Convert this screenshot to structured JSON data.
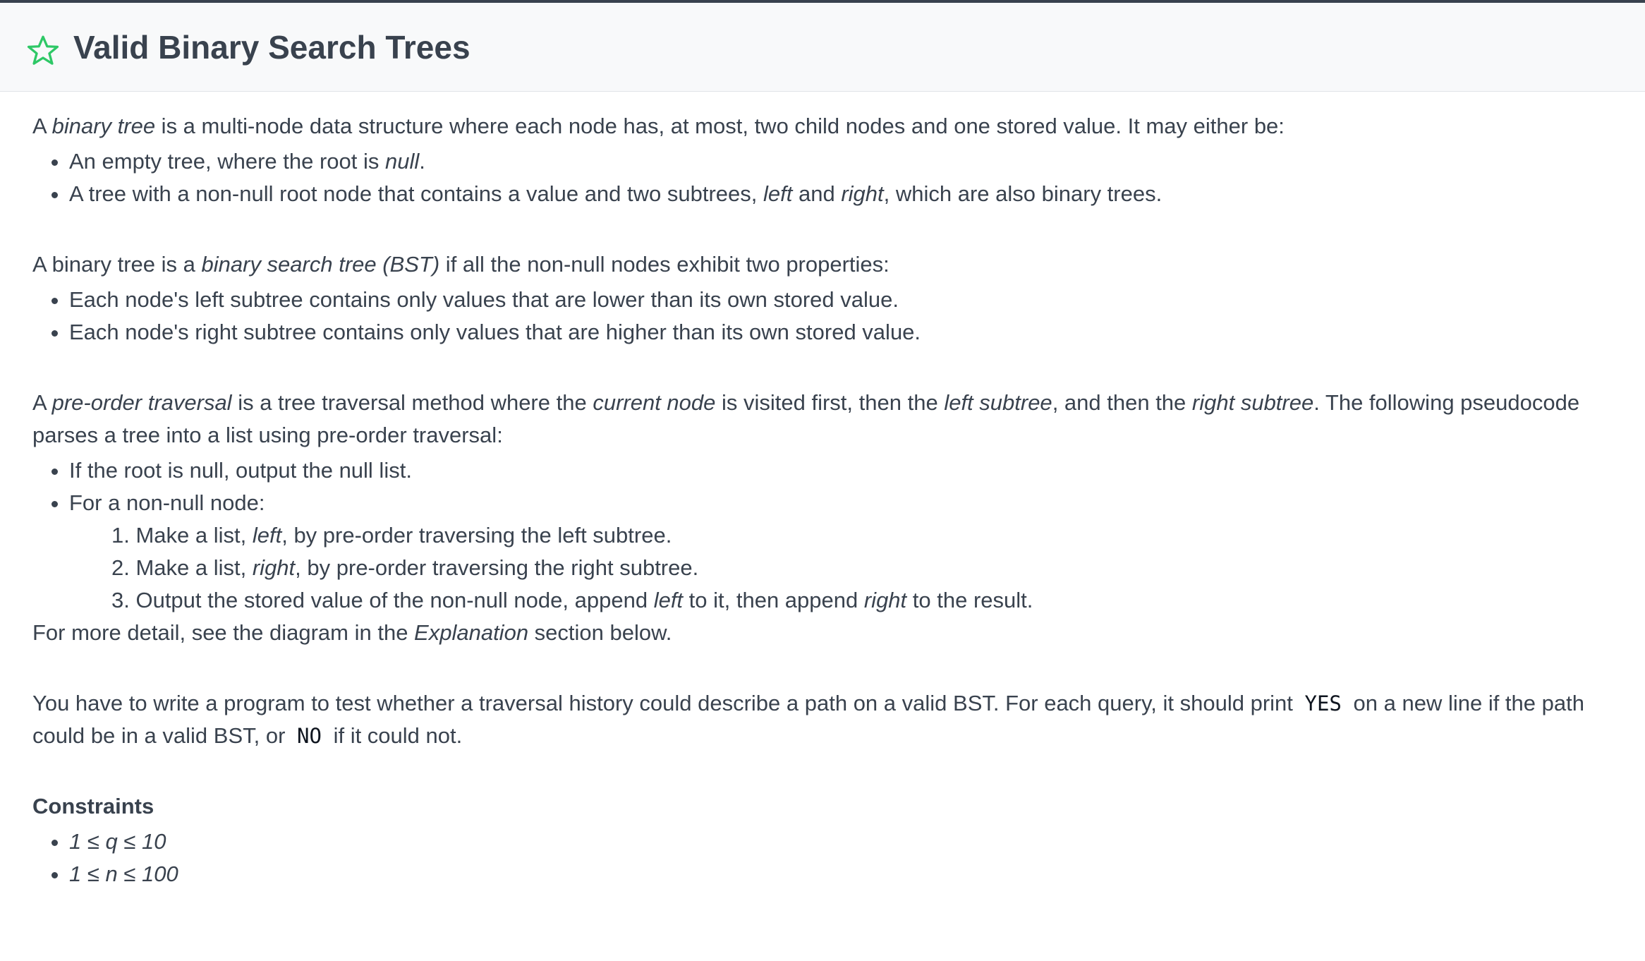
{
  "header": {
    "title": "Valid Binary Search Trees",
    "star_icon": "star-outline-icon",
    "accent": "#2ec866"
  },
  "p1": {
    "a": "A ",
    "em1": "binary tree",
    "b": " is a multi-node data structure where each node has, at most, two child nodes and one stored value. It may either be:",
    "li1": {
      "a": "An empty tree, where the root is ",
      "em1": "null",
      "b": "."
    },
    "li2": {
      "a": "A tree with a non-null root node that contains a value and two subtrees, ",
      "em1": "left",
      "b": " and ",
      "em2": "right",
      "c": ", which are also binary trees."
    }
  },
  "p2": {
    "a": "A binary tree is a ",
    "em1": "binary search tree (BST)",
    "b": " if all the non-null nodes exhibit two properties:",
    "li1": "Each node's left subtree contains only values that are lower than its own stored value.",
    "li2": "Each node's right subtree contains only values that are higher than its own stored value."
  },
  "p3": {
    "a": "A ",
    "em1": "pre-order traversal",
    "b": " is a tree traversal method where the ",
    "em2": "current node",
    "c": " is visited first, then the ",
    "em3": "left subtree",
    "d": ", and then the ",
    "em4": "right subtree",
    "e": ". The following pseudocode parses a tree into a list using pre-order traversal:",
    "li1": "If the root is null, output the null list.",
    "li2": "For a non-null node:",
    "ol1": {
      "n": "1. ",
      "a": "Make a list, ",
      "em1": "left",
      "b": ", by pre-order traversing the left subtree."
    },
    "ol2": {
      "n": "2. ",
      "a": "Make a list, ",
      "em1": "right",
      "b": ", by pre-order traversing the right subtree."
    },
    "ol3": {
      "n": "3. ",
      "a": "Output the stored value of the non-null node, append ",
      "em1": "left",
      "b": " to it, then append ",
      "em2": "right",
      "c": " to the result."
    },
    "more": {
      "a": "For more detail, see the diagram in the ",
      "em1": "Explanation",
      "b": " section below."
    }
  },
  "p4": {
    "a": "You have to write a program to test whether a traversal history could describe a path on a valid BST. For each query, it should print ",
    "code1": "YES",
    "b": " on a new line if the path could be in a valid BST, or ",
    "code2": "NO",
    "c": " if it could not."
  },
  "constraints": {
    "heading": "Constraints",
    "items": [
      "1 ≤ q ≤ 10",
      "1 ≤ n ≤ 100"
    ]
  }
}
